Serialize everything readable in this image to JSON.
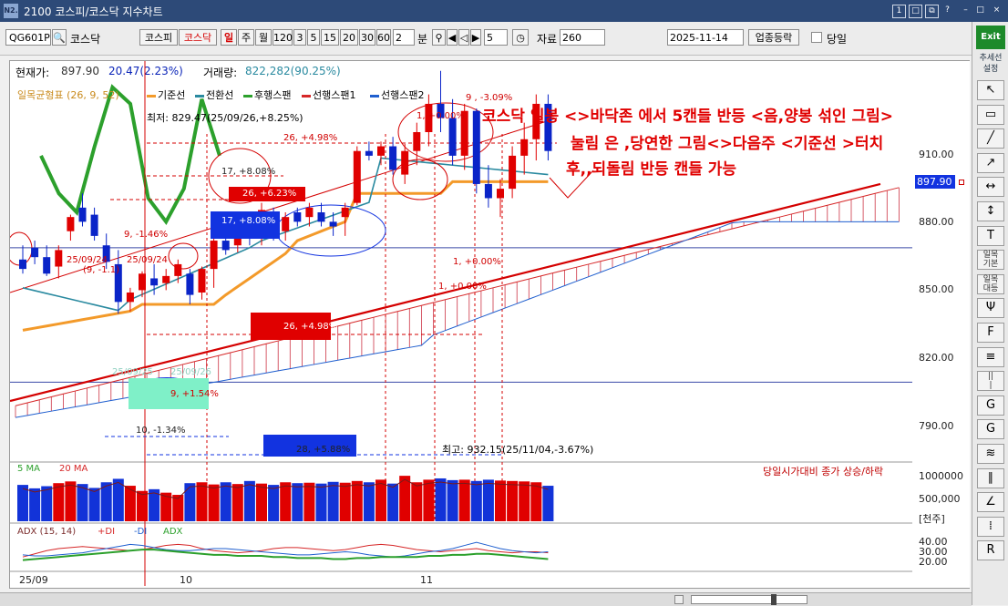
{
  "window": {
    "title": "2100 코스피/코스닥 지수차트",
    "logo": "N2.",
    "buttons": [
      "1",
      "□",
      "⧉",
      "?",
      "–",
      "□",
      "×"
    ]
  },
  "toolbar": {
    "code": "QG601P",
    "name": "코스닥",
    "market_tabs": [
      "코스피",
      "코스닥"
    ],
    "active_market": "코스닥",
    "periods": [
      "일",
      "주",
      "월",
      "120",
      "3",
      "5",
      "15",
      "20",
      "30",
      "60"
    ],
    "active_period": "일",
    "count_value": "2",
    "count_unit": "분",
    "nav_value": "5",
    "data_label": "자료",
    "data_value": "260",
    "date_value": "2025-11-14",
    "sort_button": "업종등락",
    "today_label": "당일"
  },
  "price_info": {
    "current_label": "현재가:",
    "current_value": "897.90",
    "change": "20.47(2.23%)",
    "volume_label": "거래량:",
    "volume_value": "822,282(90.25%)"
  },
  "legend": {
    "main": "일목균형표 (26, 9, 52)",
    "items": [
      {
        "label": "기준선",
        "color": "#f39a2a"
      },
      {
        "label": "전환선",
        "color": "#2a8aa0"
      },
      {
        "label": "후행스팬",
        "color": "#2ca02c"
      },
      {
        "label": "선행스팬1",
        "color": "#d62728"
      },
      {
        "label": "선행스팬2",
        "color": "#1f5fcf"
      }
    ]
  },
  "annotations": {
    "line1": "코스닥 일봉 <>바닥존 에서 5캔들 반등 <음,양봉 섞인 그림>",
    "line2": "눌림 은 ,당연한 그림<>다음주 <기준선 >터치",
    "line3": "후,,되돌림 반등 캔들 가능"
  },
  "chart_labels": {
    "high": "최저: 829.47(25/09/26,+8.25%)",
    "low_marker": "최고: 932.15(25/11/04,-3.67%)",
    "l_26_498_top": "26, +4.98%",
    "l_17_808a": "17, +8.08%",
    "l_26_623": "26, +6.23%",
    "l_17_808b": "17, +8.08%",
    "l_9_146": "9, -1.46%",
    "l_9_309": "9 , -3.09%",
    "l_1_000a": "1, +0.00%",
    "l_1_000b": "1, +0.00%",
    "l_1_000c": "1, +0.00%",
    "l_26_498_bottom": "26, +4.98%",
    "l_9_154": "9, +1.54%",
    "l_10_134": "10, -1.34%",
    "l_28_588": "28, +5.88%",
    "d_250924a": "25/09/24",
    "d_250924b": "25/09/24",
    "d_9_1": "(9, -1.1)",
    "d_250925": "25/09/25",
    "d_250926": "25/09/26"
  },
  "y_axis": {
    "main_ticks": [
      "910.00",
      "880.00",
      "850.00",
      "820.00",
      "790.00"
    ],
    "current_price": "897.90",
    "volume_ticks": [
      "1000000",
      "500,000"
    ],
    "volume_unit": "[천주]",
    "adx_ticks": [
      "40.00",
      "30.00",
      "20.00"
    ]
  },
  "x_axis": {
    "labels": [
      "25/09",
      "10",
      "11"
    ]
  },
  "volume_panel": {
    "legend": [
      "5 MA",
      "20 MA"
    ],
    "note": "당일시가대비 종가 상승/하락"
  },
  "adx_panel": {
    "legend": [
      "ADX (15, 14)",
      "+DI",
      "-DI",
      "ADX"
    ]
  },
  "sidebar": {
    "exit": "Exit",
    "settings": "추세선\n설정",
    "buttons": [
      "↖",
      "▭",
      "╱",
      "↗",
      "↔",
      "↕",
      "T",
      "일목기본",
      "일목대등",
      "Ψ",
      "F",
      "≡",
      "|||",
      "G",
      "G",
      "≋",
      "∥",
      "∠",
      "⁞",
      "R"
    ]
  },
  "chart_data": [
    {
      "type": "candlestick",
      "title": "",
      "ylim": [
        770,
        940
      ],
      "x": [
        "25/09",
        "10",
        "11"
      ],
      "series": [
        {
          "name": "",
          "ohlc": [
            [
              852,
              858,
              846,
              848
            ],
            [
              857,
              860,
              850,
              853
            ],
            [
              853,
              858,
              845,
              846
            ],
            [
              849,
              858,
              844,
              856
            ],
            [
              864,
              871,
              860,
              870
            ],
            [
              874,
              880,
              866,
              868
            ],
            [
              871,
              874,
              860,
              862
            ],
            [
              858,
              863,
              848,
              851
            ],
            [
              850,
              856,
              829,
              834
            ],
            [
              834,
              840,
              830,
              838
            ],
            [
              839,
              847,
              836,
              846
            ],
            [
              844,
              850,
              837,
              841
            ],
            [
              842,
              848,
              839,
              845
            ],
            [
              845,
              852,
              842,
              850
            ],
            [
              846,
              848,
              833,
              837
            ],
            [
              838,
              849,
              835,
              848
            ],
            [
              848,
              862,
              840,
              860
            ],
            [
              860,
              870,
              854,
              856
            ],
            [
              858,
              868,
              855,
              866
            ],
            [
              866,
              870,
              858,
              861
            ],
            [
              862,
              876,
              858,
              873
            ],
            [
              868,
              874,
              860,
              864
            ],
            [
              864,
              872,
              860,
              870
            ],
            [
              872,
              874,
              866,
              868
            ],
            [
              870,
              876,
              866,
              874
            ],
            [
              872,
              876,
              866,
              868
            ],
            [
              868,
              872,
              862,
              866
            ],
            [
              870,
              876,
              862,
              874
            ],
            [
              876,
              900,
              875,
              898
            ],
            [
              898,
              902,
              894,
              896
            ],
            [
              896,
              902,
              892,
              900
            ],
            [
              900,
              904,
              888,
              890
            ],
            [
              888,
              901,
              884,
              898
            ],
            [
              898,
              910,
              892,
              906
            ],
            [
              906,
              922,
              900,
              918
            ],
            [
              918,
              932,
              906,
              912
            ],
            [
              912,
              920,
              892,
              896
            ],
            [
              896,
              918,
              890,
              915
            ],
            [
              915,
              916,
              880,
              884
            ],
            [
              884,
              892,
              874,
              878
            ],
            [
              878,
              886,
              870,
              882
            ],
            [
              882,
              900,
              878,
              896
            ],
            [
              896,
              910,
              888,
              903
            ],
            [
              903,
              922,
              894,
              918
            ],
            [
              918,
              922,
              894,
              898
            ]
          ]
        }
      ]
    },
    {
      "type": "bar",
      "title": "",
      "ylim": [
        0,
        1200000
      ],
      "series": [
        {
          "name": "",
          "values": [
            840000,
            760000,
            810000,
            880000,
            920000,
            860000,
            770000,
            900000,
            980000,
            820000,
            700000,
            740000,
            660000,
            610000,
            880000,
            900000,
            850000,
            900000,
            860000,
            930000,
            870000,
            840000,
            900000,
            880000,
            890000,
            870000,
            910000,
            890000,
            930000,
            900000,
            960000,
            870000,
            1050000,
            900000,
            960000,
            990000,
            950000,
            960000,
            930000,
            960000,
            940000,
            930000,
            920000,
            900000,
            820000
          ]
        }
      ]
    },
    {
      "type": "line",
      "title": "",
      "ylim": [
        10,
        50
      ],
      "series": [
        {
          "name": "+DI",
          "values": [
            22,
            25,
            28,
            30,
            31,
            32,
            31,
            30,
            29,
            28,
            29,
            31,
            33,
            34,
            33,
            30,
            28,
            27,
            26,
            27,
            28,
            30,
            31,
            31,
            30,
            29,
            28,
            29,
            31,
            33,
            34,
            33,
            31,
            29,
            28,
            27,
            28,
            29,
            30,
            28,
            27,
            26,
            27,
            27,
            26
          ]
        },
        {
          "name": "-DI",
          "values": [
            24,
            23,
            23,
            24,
            25,
            26,
            28,
            30,
            32,
            34,
            33,
            31,
            29,
            28,
            28,
            29,
            30,
            30,
            29,
            28,
            27,
            26,
            25,
            24,
            24,
            25,
            26,
            27,
            26,
            24,
            23,
            22,
            23,
            25,
            27,
            28,
            30,
            33,
            36,
            33,
            30,
            28,
            27,
            26,
            27
          ]
        },
        {
          "name": "ADX",
          "values": [
            19,
            20,
            21,
            22,
            23,
            24,
            25,
            26,
            27,
            28,
            29,
            29,
            28,
            27,
            26,
            25,
            24,
            24,
            23,
            23,
            23,
            22,
            22,
            21,
            21,
            21,
            20,
            20,
            21,
            21,
            22,
            22,
            22,
            22,
            23,
            23,
            24,
            24,
            25,
            25,
            24,
            23,
            22,
            21,
            20
          ]
        }
      ]
    }
  ]
}
